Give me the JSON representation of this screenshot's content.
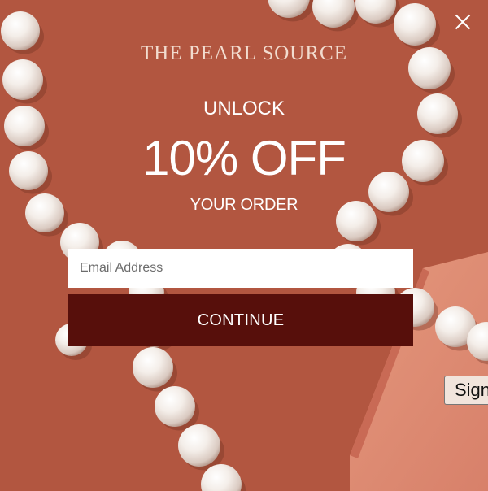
{
  "popup": {
    "brand": "THE PEARL SOURCE",
    "headline_top": "UNLOCK",
    "headline_main": "10% OFF",
    "headline_bottom": "YOUR ORDER",
    "email_placeholder": "Email Address",
    "email_value": "",
    "continue_label": "CONTINUE",
    "close_icon": "close-icon"
  },
  "side_tab": {
    "label": "Sign"
  },
  "colors": {
    "background": "#b75a43",
    "button": "#570f0b",
    "text": "#ffffff",
    "brand_text": "#f2dccf"
  }
}
